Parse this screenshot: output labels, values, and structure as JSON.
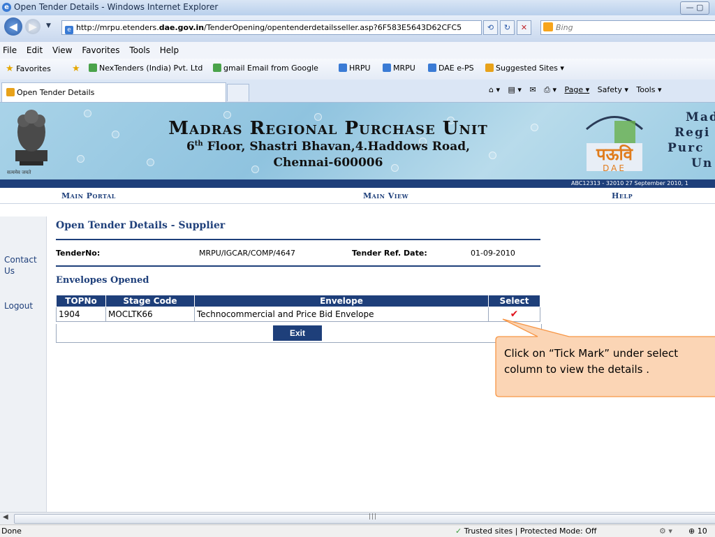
{
  "browser": {
    "window_title": "Open Tender Details - Windows Internet Explorer",
    "url_prefix": "http://mrpu.etenders.",
    "url_domain": "dae.gov.in",
    "url_suffix": "/TenderOpening/opentenderdetailsseller.asp?6F583E5643D62CFC5",
    "search_engine": "Bing",
    "menu": [
      "File",
      "Edit",
      "View",
      "Favorites",
      "Tools",
      "Help"
    ],
    "favorites_label": "Favorites",
    "favorites": [
      "NexTenders (India) Pvt. Ltd",
      "gmail Email from Google",
      "HRPU",
      "MRPU",
      "DAE e-PS",
      "Suggested Sites ▾"
    ],
    "tab_title": "Open Tender Details",
    "commands": [
      "Page ▾",
      "Safety ▾",
      "Tools ▾"
    ],
    "status_left": "Done",
    "status_zone": "Trusted sites | Protected Mode: Off",
    "zoom": "10"
  },
  "banner": {
    "title": "Madras Regional Purchase Unit",
    "floor_num": "6",
    "floor_sup": "th",
    "address_rest": " Floor, Shastri Bhavan,4.Haddows Road,",
    "city": "Chennai-600006",
    "emblem_caption": "सत्यमेव जयते",
    "right_logo_text": "पऊवि",
    "right_logo_sub": "DAE",
    "right_text_lines": [
      "Mad",
      "Regi",
      "Purc",
      "Un"
    ],
    "meta": "ABC12313 - 32010     27 September 2010,  1"
  },
  "nav": {
    "main_portal": "Main Portal",
    "main_view": "Main View",
    "help": "Help"
  },
  "sidebar": {
    "contact_line1": "Contact",
    "contact_line2": "Us",
    "logout": "Logout"
  },
  "page": {
    "heading": "Open Tender Details - Supplier",
    "tender_no_label": "TenderNo:",
    "tender_no": "MRPU/IGCAR/COMP/4647",
    "tender_ref_label": "Tender Ref. Date:",
    "tender_ref_date": "01-09-2010",
    "envelopes_heading": "Envelopes Opened",
    "table": {
      "headers": [
        "TOPNo",
        "Stage Code",
        "Envelope",
        "Select"
      ],
      "rows": [
        {
          "topno": "1904",
          "stage_code": "MOCLTK66",
          "envelope": "Technocommercial and Price Bid Envelope",
          "select": "✔"
        }
      ]
    },
    "exit_label": "Exit"
  },
  "callout": {
    "text": "Click on “Tick Mark” under select column to view the details ."
  },
  "colors": {
    "navy": "#1e3f7a",
    "callout_fill": "#fbd5b5",
    "callout_stroke": "#f79646",
    "tick": "#e0141e"
  }
}
